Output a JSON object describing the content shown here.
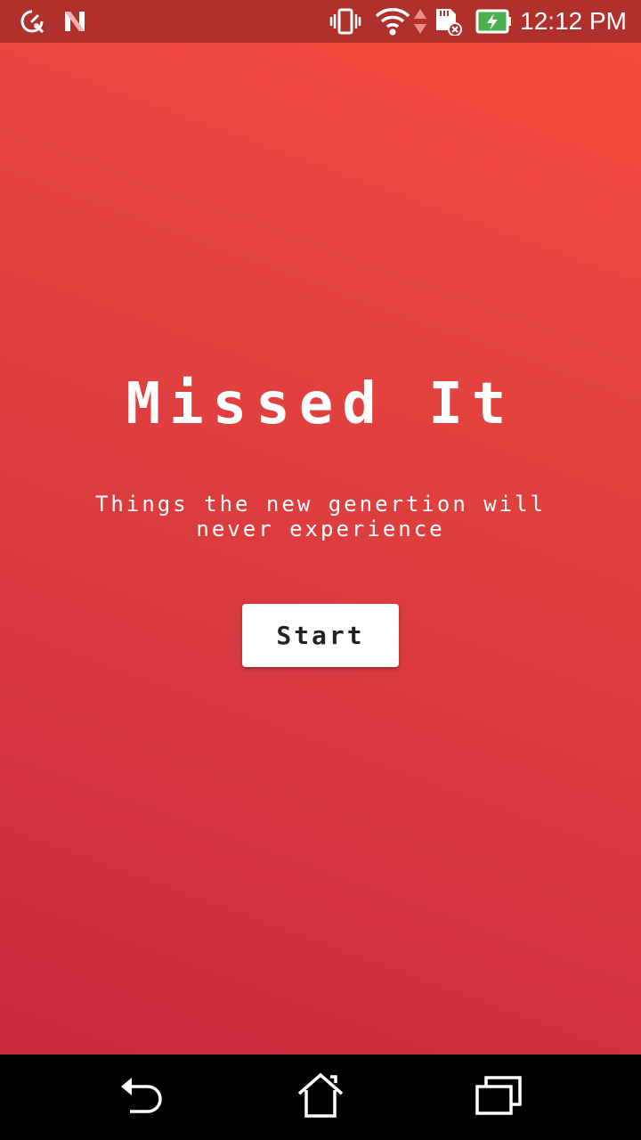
{
  "status_bar": {
    "time": "12:12 PM",
    "icons": [
      "speedometer-wrench-icon",
      "n-notification-icon",
      "vibrate-icon",
      "wifi-icon",
      "data-arrows-icon",
      "sd-card-error-icon",
      "battery-charging-icon"
    ],
    "background": "#b0312c"
  },
  "app": {
    "title": "Missed It",
    "subtitle": "Things the new genertion will never experience",
    "start_label": "Start",
    "gradient_top": "#f24a3d",
    "gradient_bottom": "#c92a3e"
  },
  "nav_bar": {
    "icons": [
      "back-icon",
      "home-icon",
      "recents-icon"
    ]
  }
}
